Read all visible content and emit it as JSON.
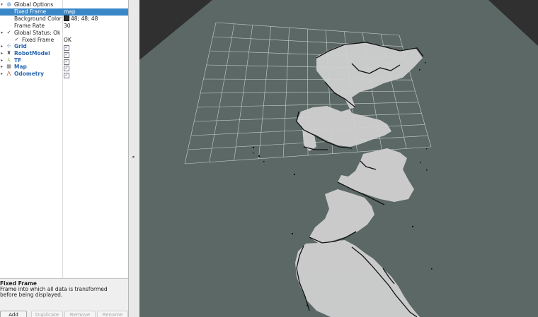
{
  "tree": {
    "global_options": {
      "label": "Global Options"
    },
    "fixed_frame": {
      "label": "Fixed Frame",
      "value": "map"
    },
    "background_color": {
      "label": "Background Color",
      "value": "48; 48; 48"
    },
    "frame_rate": {
      "label": "Frame Rate",
      "value": "30"
    },
    "global_status": {
      "label": "Global Status: Ok"
    },
    "status_fixed_frame": {
      "label": "Fixed Frame",
      "value": "OK"
    },
    "displays": [
      {
        "label": "Grid",
        "checked": true
      },
      {
        "label": "RobotModel",
        "checked": true
      },
      {
        "label": "TF",
        "checked": true
      },
      {
        "label": "Map",
        "checked": true
      },
      {
        "label": "Odometry",
        "checked": true
      }
    ]
  },
  "help": {
    "title": "Fixed Frame",
    "text": "Frame into which all data is transformed before being displayed."
  },
  "buttons": {
    "add": "Add",
    "duplicate": "Duplicate",
    "remove": "Remove",
    "rename": "Rename"
  },
  "colors": {
    "viewport_bg": "#303030",
    "ground": "#5b6865",
    "grid": "#c7cfcc",
    "selection": "#3a87c8",
    "map_free": "#d2d2d2",
    "map_wall": "#111111"
  }
}
